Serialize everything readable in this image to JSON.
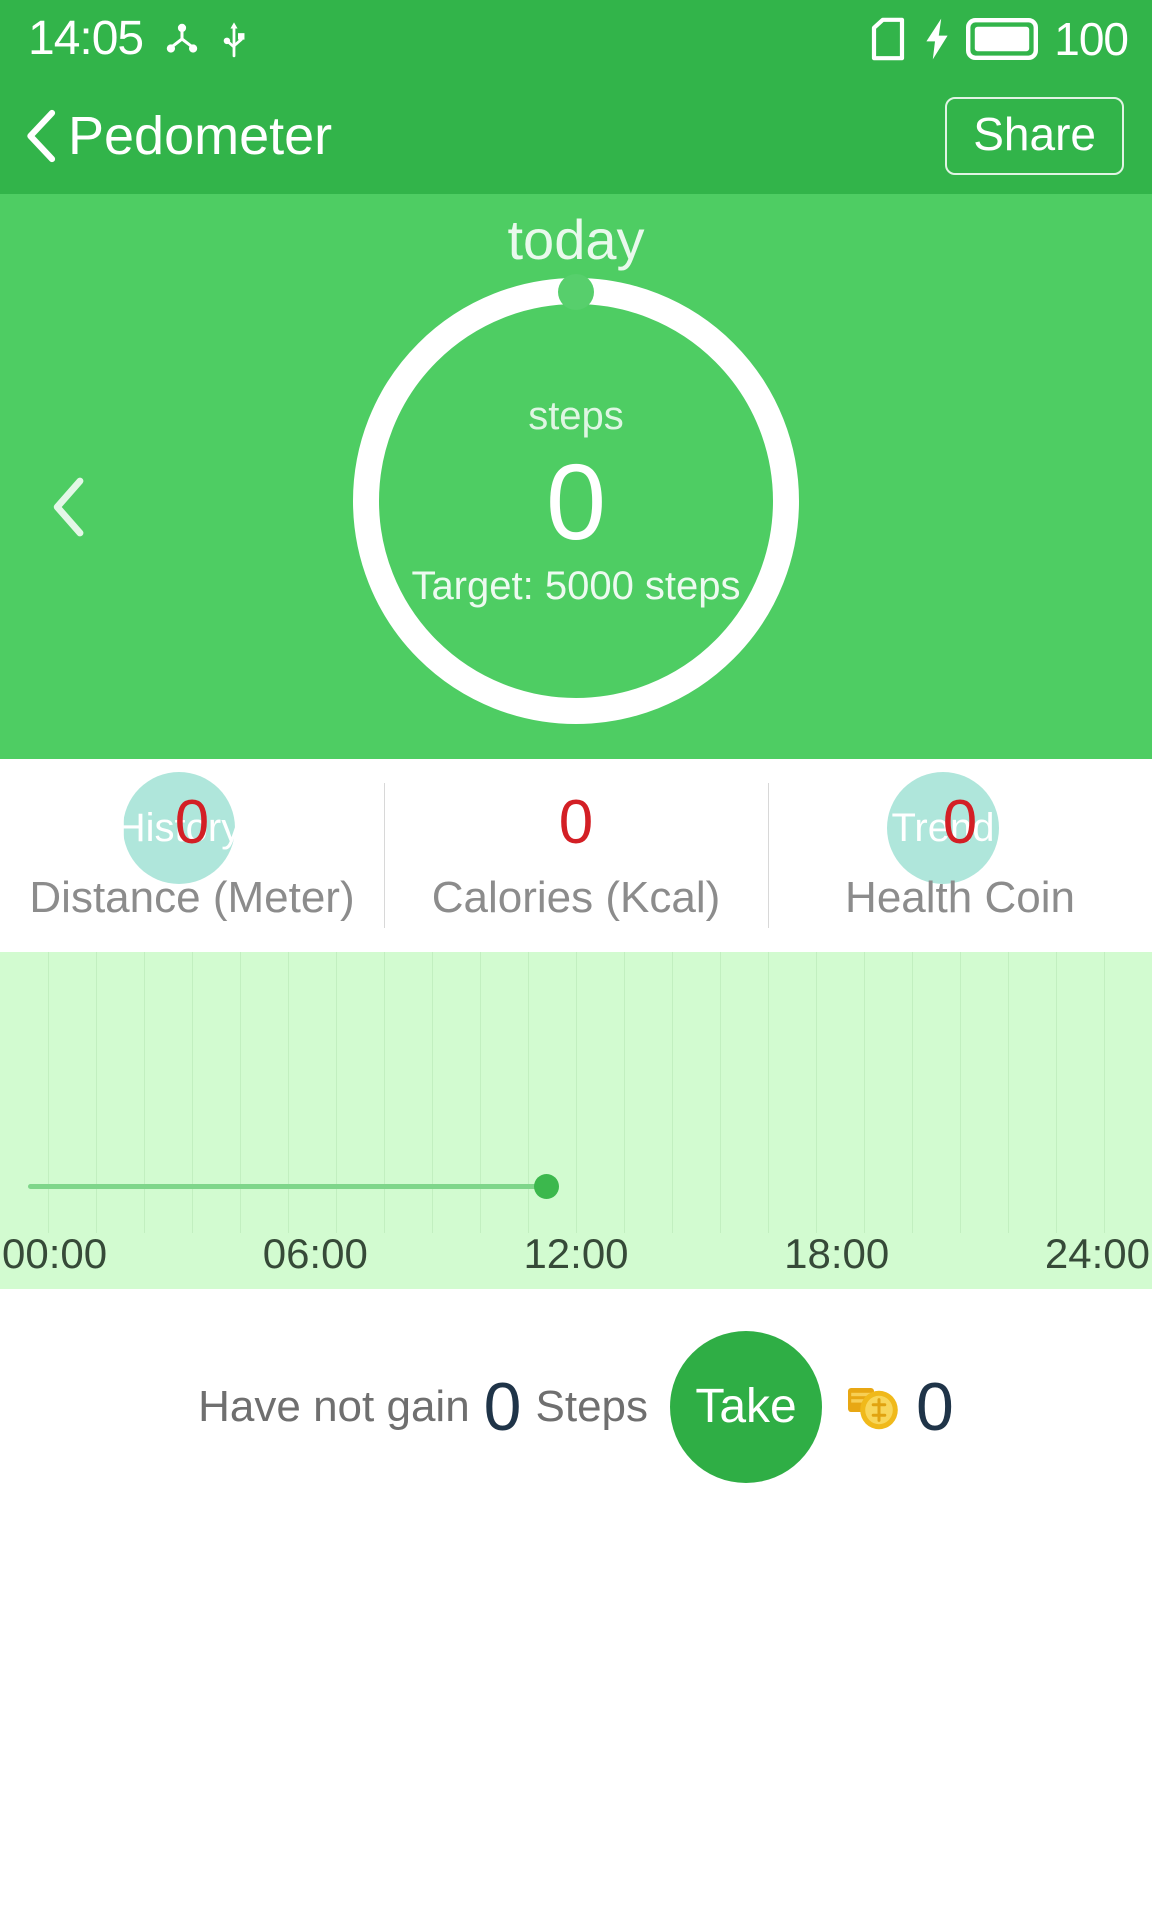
{
  "statusbar": {
    "time": "14:05",
    "battery_percent": "100",
    "icons": [
      "cast-icon",
      "usb-icon",
      "sim-card-icon",
      "charging-bolt-icon",
      "battery-full-icon"
    ]
  },
  "appbar": {
    "back_label": "back-chevron-icon",
    "title": "Pedometer",
    "share_label": "Share"
  },
  "hero": {
    "day_label": "today",
    "steps_label": "steps",
    "steps_value": "0",
    "target_text": "Target: 5000 steps",
    "prev_day_icon": "chevron-left-icon",
    "history_label": "History",
    "trend_label": "Trend",
    "ring_color": "#ffffff",
    "panel_color": "#4ecd63"
  },
  "stats": {
    "items": [
      {
        "value": "0",
        "label": "Distance (Meter)"
      },
      {
        "value": "0",
        "label": "Calories (Kcal)"
      },
      {
        "value": "0",
        "label": "Health Coin"
      }
    ],
    "value_color": "#d31f25"
  },
  "chart_data": {
    "type": "line",
    "title": "",
    "xlabel": "",
    "ylabel": "",
    "x_tick_labels": [
      "00:00",
      "06:00",
      "12:00",
      "18:00",
      "24:00"
    ],
    "x": [
      0,
      6,
      12,
      14.08
    ],
    "values": [
      0,
      0,
      0,
      0
    ],
    "series": [
      {
        "name": "steps",
        "values": [
          0,
          0,
          0,
          0
        ]
      }
    ],
    "xlim": [
      0,
      24
    ],
    "ylim": [
      0,
      5000
    ],
    "grid": true,
    "legend": "none",
    "current_marker_time": "14:05",
    "line_color": "#7fd68a",
    "marker_color": "#3cb84d",
    "background": "#d2fbd0"
  },
  "bottom": {
    "gain_prefix": "Have not gain",
    "gain_value": "0",
    "gain_suffix": "Steps",
    "take_label": "Take",
    "coin_icon": "coins-icon",
    "coin_count": "0"
  }
}
